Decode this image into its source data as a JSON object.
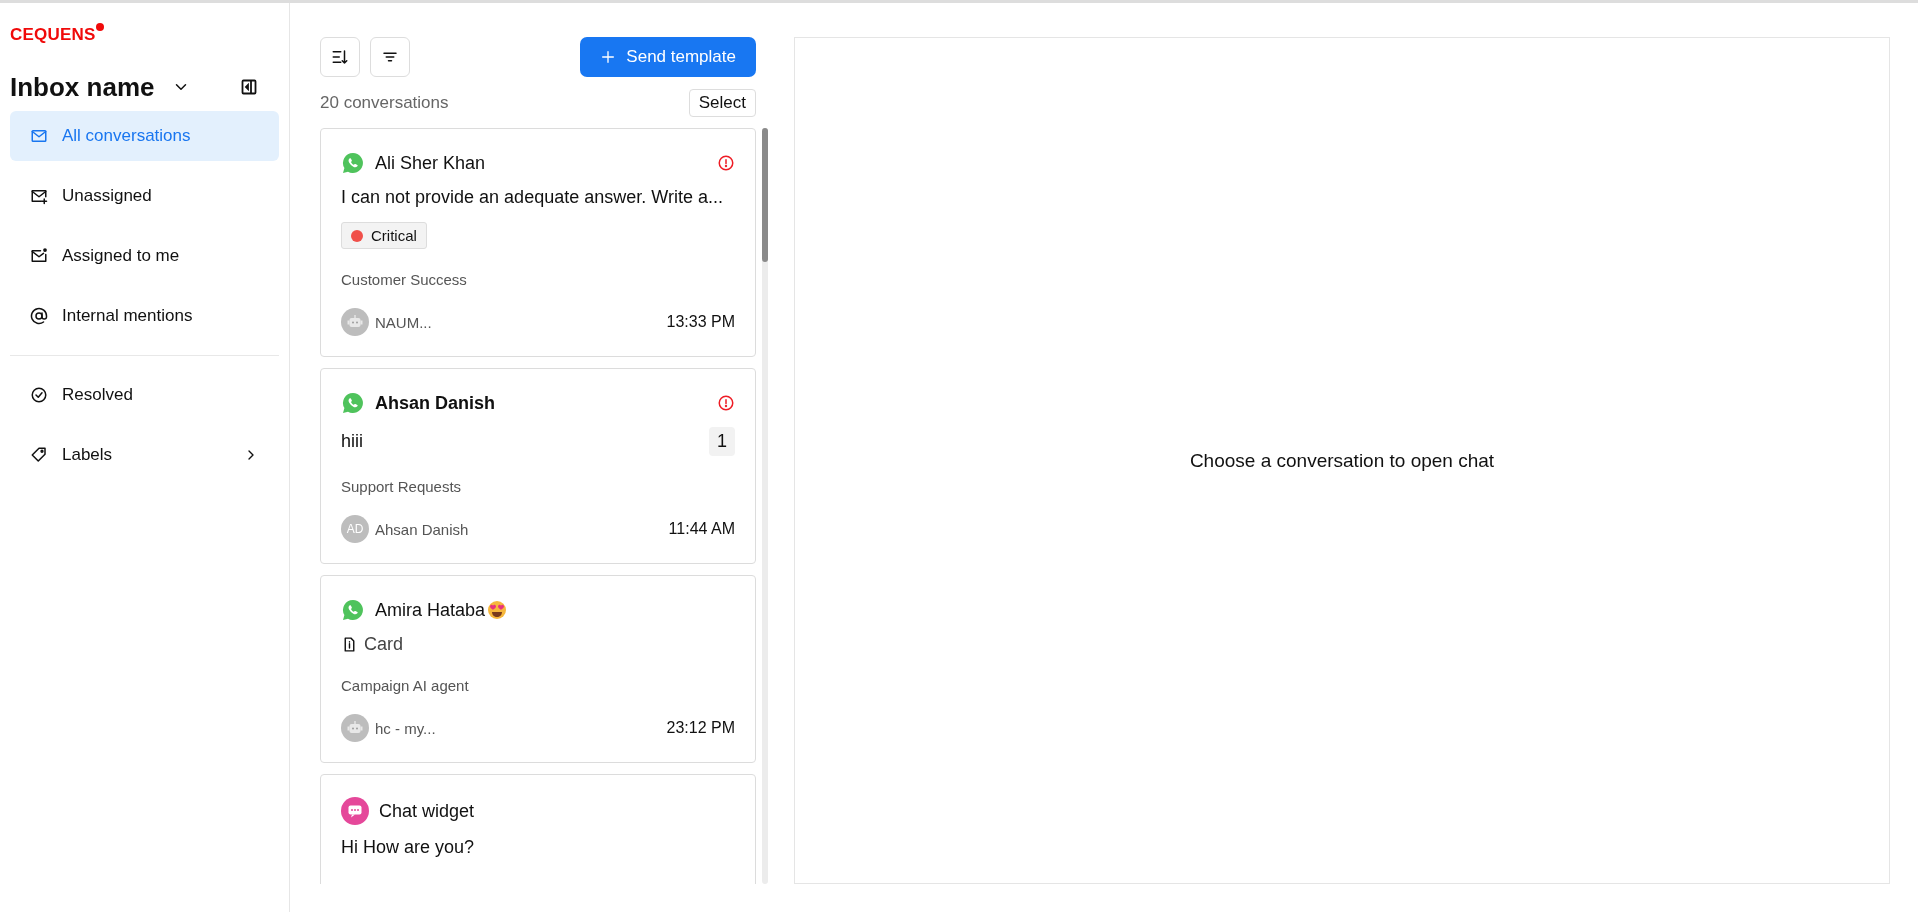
{
  "sidebar": {
    "logo": "CEQUENS",
    "inbox_title": "Inbox name",
    "sections": [
      [
        {
          "label": "All conversations",
          "selected": true
        },
        {
          "label": "Unassigned",
          "selected": false
        },
        {
          "label": "Assigned to me",
          "selected": false
        },
        {
          "label": "Internal mentions",
          "selected": false
        }
      ],
      [
        {
          "label": "Resolved",
          "selected": false
        },
        {
          "label": "Labels",
          "selected": false,
          "has_submenu": true
        }
      ]
    ]
  },
  "list": {
    "send_template": "Send template",
    "count": "20 conversations",
    "select": "Select",
    "conversations": [
      {
        "kind": "whatsapp",
        "name": "Ali Sher Khan",
        "unread": false,
        "urgent": true,
        "preview": "I can not provide an adequate answer. Write a...",
        "label": {
          "text": "Critical",
          "color": "#f0504a"
        },
        "team": "Customer Success",
        "assignee": {
          "kind": "bot",
          "name": "NAUM..."
        },
        "time": "13:33 PM"
      },
      {
        "kind": "whatsapp",
        "name": "Ahsan Danish",
        "unread": true,
        "urgent": true,
        "preview": "hiii",
        "unread_count": "1",
        "team": "Support Requests",
        "assignee": {
          "kind": "person",
          "initials": "AD",
          "name": "Ahsan Danish"
        },
        "time": "11:44 AM"
      },
      {
        "kind": "whatsapp",
        "name": "Amira Hataba",
        "emoji": true,
        "unread": false,
        "urgent": false,
        "preview": "Card",
        "attachment": true,
        "team": "Campaign AI agent",
        "assignee": {
          "kind": "bot",
          "name": "hc - my..."
        },
        "time": "23:12 PM"
      },
      {
        "kind": "widget",
        "name": "Chat widget",
        "unread": false,
        "urgent": false,
        "preview": "Hi How are you?"
      }
    ]
  },
  "chat": {
    "empty_text": "Choose a conversation to open chat"
  }
}
